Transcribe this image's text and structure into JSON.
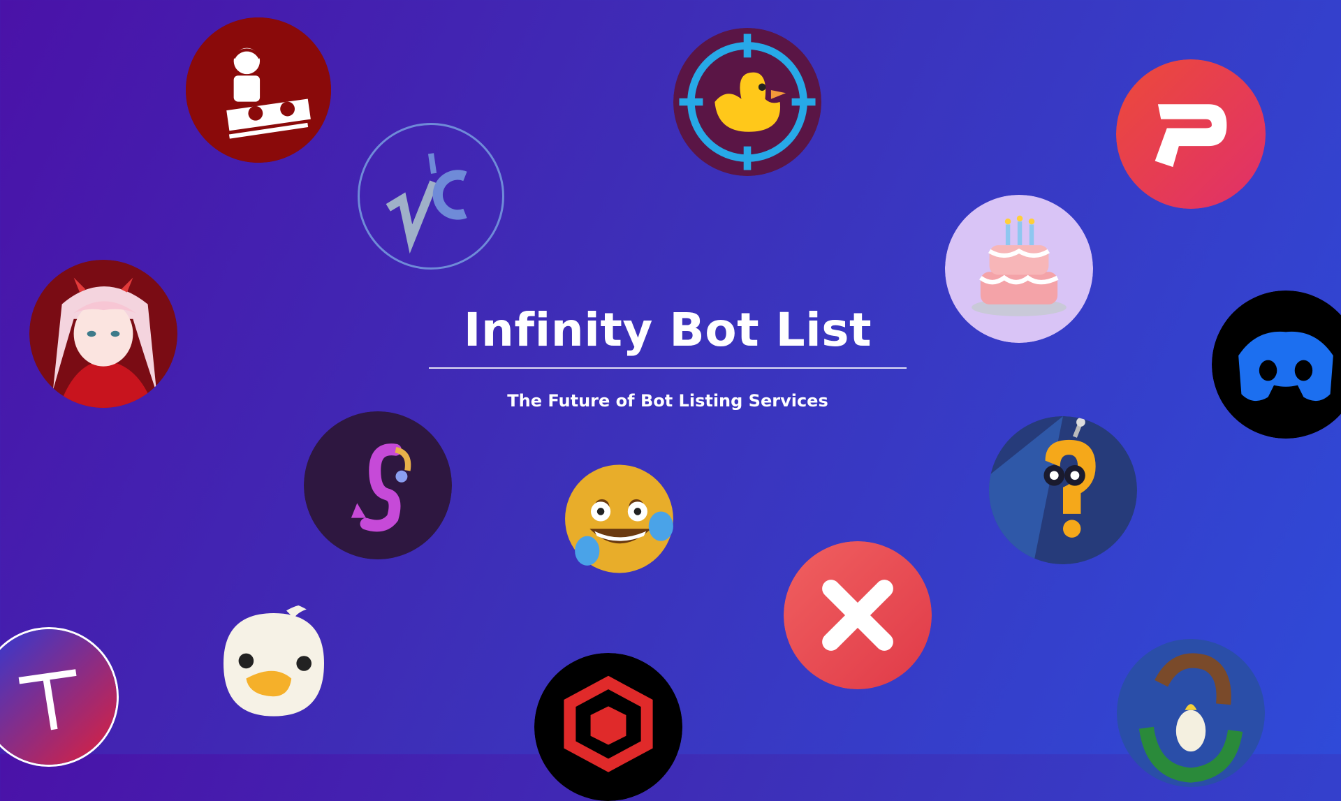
{
  "hero": {
    "title": "Infinity Bot List",
    "subtitle": "The Future of Bot Listing Services"
  },
  "avatars": [
    {
      "icon": "dj-turntable-icon",
      "color": "#8b0000"
    },
    {
      "icon": "nc-monogram-icon",
      "color": "#3d3bb5"
    },
    {
      "icon": "duck-target-icon",
      "color": "#5a1545"
    },
    {
      "icon": "p-logo-icon",
      "color": "#ea3a4a"
    },
    {
      "icon": "birthday-cake-icon",
      "color": "#d7c2f5"
    },
    {
      "icon": "anime-girl-icon",
      "color": "#8e0e17"
    },
    {
      "icon": "discord-icon",
      "color": "#000000"
    },
    {
      "icon": "music-note-icon",
      "color": "#2e1740"
    },
    {
      "icon": "laughing-emoji-icon",
      "color": "#e3a92a"
    },
    {
      "icon": "robot-question-icon",
      "color": "#263b7a"
    },
    {
      "icon": "close-x-icon",
      "color": "#e64848"
    },
    {
      "icon": "t-logo-icon",
      "color": "#2f2a90"
    },
    {
      "icon": "duck-face-icon",
      "color": "#f6f2e6"
    },
    {
      "icon": "red-cube-icon",
      "color": "#000000"
    },
    {
      "icon": "horse-parrot-icon",
      "color": "#2a4ea8"
    }
  ]
}
